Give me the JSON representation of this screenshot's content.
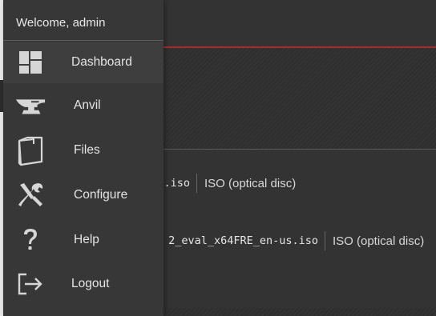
{
  "drawer": {
    "welcome": "Welcome, admin",
    "items": [
      {
        "label": "Dashboard",
        "icon": "dashboard-icon"
      },
      {
        "label": "Anvil",
        "icon": "anvil-icon"
      },
      {
        "label": "Files",
        "icon": "folder-icon"
      },
      {
        "label": "Configure",
        "icon": "tools-icon"
      },
      {
        "label": "Help",
        "icon": "help-icon"
      },
      {
        "label": "Logout",
        "icon": "logout-icon"
      }
    ]
  },
  "files": [
    {
      "name": ".iso",
      "type": "ISO (optical disc)"
    },
    {
      "name": "2_eval_x64FRE_en-us.iso",
      "type": "ISO (optical disc)"
    }
  ],
  "colors": {
    "drawer_bg": "#373737",
    "accent_line": "#b0282c",
    "icon": "#d6d6d6"
  }
}
